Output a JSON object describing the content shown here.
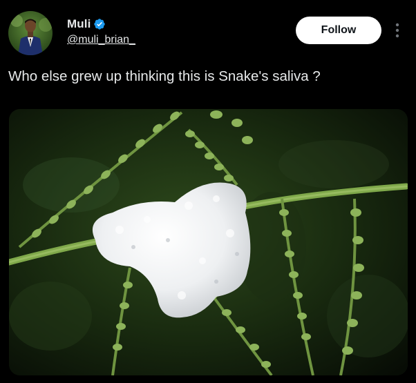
{
  "post": {
    "author": {
      "display_name": "Muli",
      "handle": "@muli_brian_",
      "verified": true
    },
    "follow_label": "Follow",
    "text": "Who else grew up thinking this is Snake's saliva ?",
    "media": {
      "icon": "photo"
    }
  },
  "colors": {
    "background": "#000000",
    "text": "#e7e9ea",
    "verified_badge": "#1d9bf0",
    "follow_button_bg": "#ffffff",
    "follow_button_text": "#0f1419"
  }
}
